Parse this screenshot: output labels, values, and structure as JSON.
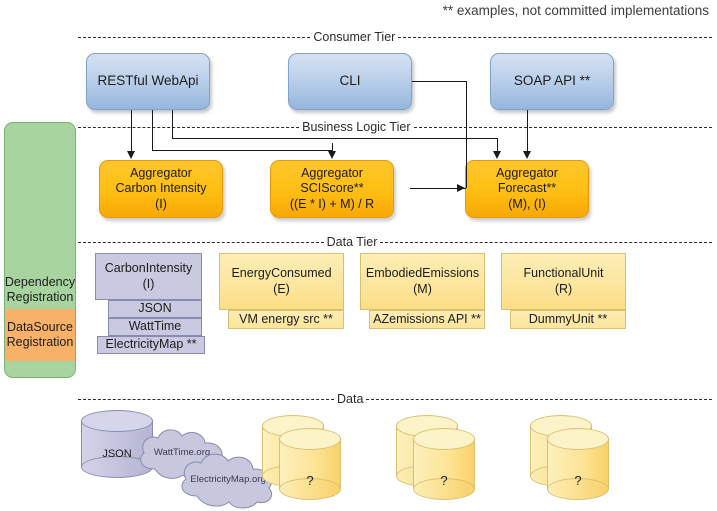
{
  "legend": {
    "note": "** examples, not committed implementations"
  },
  "tiers": [
    {
      "label": "Consumer Tier"
    },
    {
      "label": "Business Logic Tier"
    },
    {
      "label": "Data Tier"
    },
    {
      "label": "Data"
    }
  ],
  "rail": {
    "dependency_label_line1": "Dependency",
    "dependency_label_line2": "Registration",
    "datasource_label_line1": "DataSource",
    "datasource_label_line2": "Registration",
    "dependency_color": "#a8d4a0",
    "datasource_color": "#f8b169"
  },
  "consumer_tier": {
    "nodes": [
      {
        "name": "restful-webapi",
        "line1": "RESTful WebApi"
      },
      {
        "name": "cli",
        "line1": "CLI"
      },
      {
        "name": "soap-api",
        "line1": "SOAP API **"
      }
    ]
  },
  "business_tier": {
    "nodes": [
      {
        "name": "aggregator-carbon-intensity",
        "line1": "Aggregator",
        "line2": "Carbon Intensity",
        "line3": "(I)"
      },
      {
        "name": "aggregator-sciscore",
        "line1": "Aggregator",
        "line2": "SCIScore**",
        "line3": "((E * I) + M) / R"
      },
      {
        "name": "aggregator-forecast",
        "line1": "Aggregator",
        "line2": "Forecast**",
        "line3": "(M), (I)"
      }
    ]
  },
  "data_tier": {
    "entities": [
      {
        "name": "carbon-intensity",
        "title": "CarbonIntensity",
        "symbol": "(I)",
        "style": "purple",
        "sources": [
          "JSON",
          "WattTime",
          "ElectricityMap **"
        ]
      },
      {
        "name": "energy-consumed",
        "title": "EnergyConsumed",
        "symbol": "(E)",
        "style": "yellow",
        "sources": [
          "VM energy src **"
        ]
      },
      {
        "name": "embodied-emissions",
        "title": "EmbodiedEmissions",
        "symbol": "(M)",
        "style": "yellow",
        "sources": [
          "AZemissions API **"
        ]
      },
      {
        "name": "functional-unit",
        "title": "FunctionalUnit",
        "symbol": "(R)",
        "style": "yellow",
        "sources": [
          "DummyUnit **"
        ]
      }
    ]
  },
  "data_layer": {
    "json_store": "JSON",
    "clouds": [
      "WattTime.org",
      "ElectricityMap.org"
    ],
    "unknown_stores": [
      "?",
      "?",
      "?"
    ]
  },
  "colors": {
    "consumer_blue": "#bcd0ea",
    "business_orange": "#ffbe12",
    "data_yellow": "#fce59c",
    "data_purple": "#c9c9e2",
    "dependency_green": "#a8d4a0",
    "datasource_orange": "#f8b169",
    "wire": "#1a1a1a"
  }
}
